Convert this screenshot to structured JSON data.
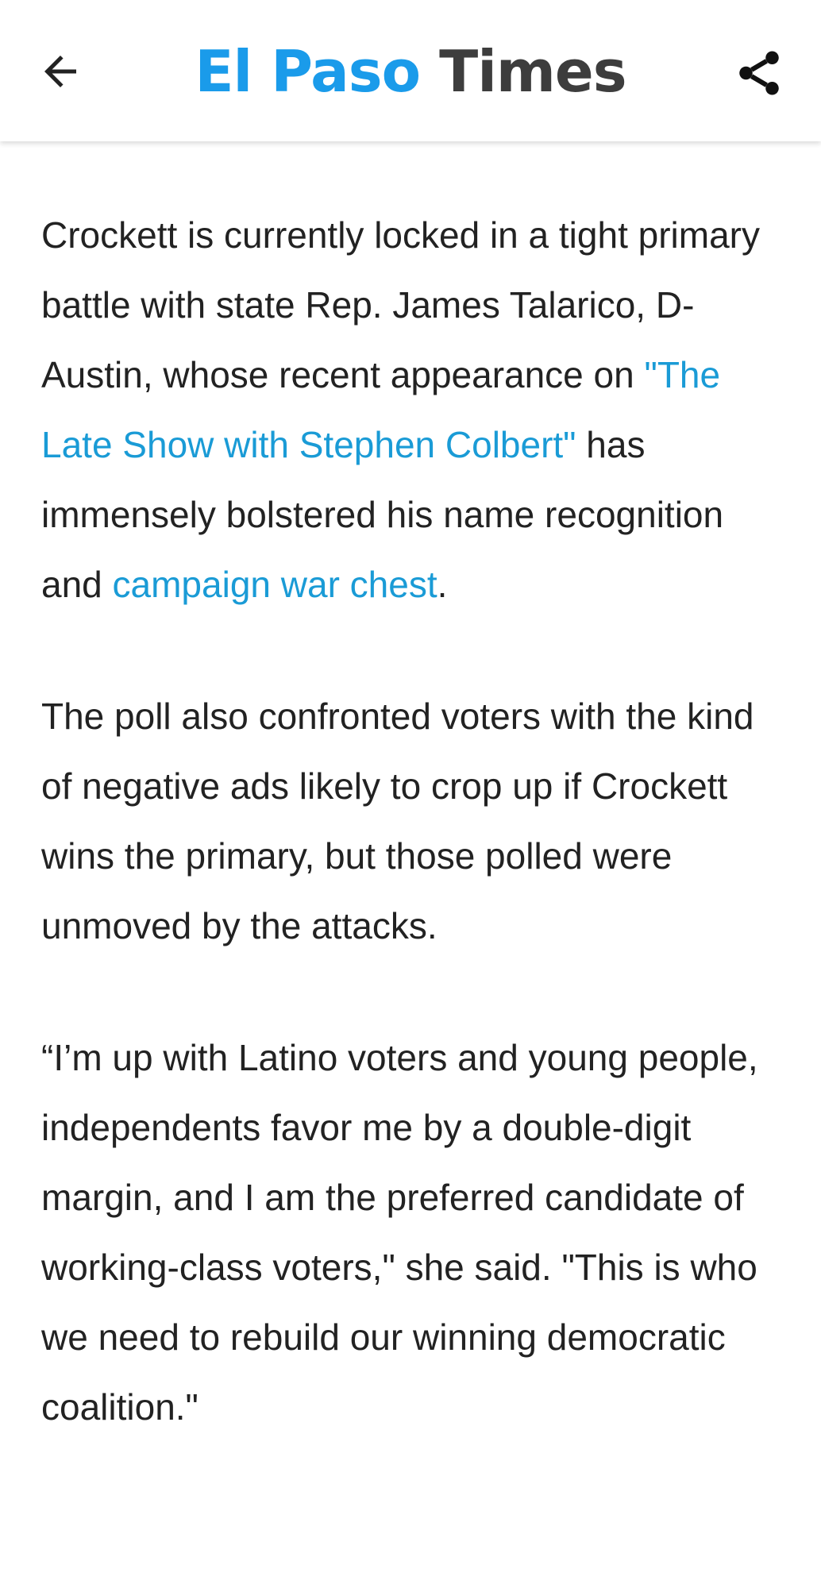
{
  "header": {
    "brand_part1": "El Paso",
    "brand_part2": "Times",
    "back_icon": "arrow-left-icon",
    "share_icon": "share-icon"
  },
  "article": {
    "p1": {
      "before_link1": "Crockett is currently locked in a tight pri­mary battle with state Rep. James Talarico, D-Austin, whose recent appear­ance on ",
      "link1": "\"The Late Show with Stephen Colbert\"",
      "between": " has immensely bolstered his name recognition and ",
      "link2": "campaign war chest",
      "after": "."
    },
    "p2": "The poll also confronted voters with the kind of negative ads likely to crop up if Crockett wins the primary, but those polled were unmoved by the attacks.",
    "p3": "“I’m up with Latino voters and young people, independents favor me by a dou­ble-digit margin, and I am the preferred candidate of working-class voters,\" she said. \"This is who we need to rebuild our winning democratic coalition.\""
  },
  "colors": {
    "brand_blue": "#1a9bea",
    "brand_dark": "#3d3d3d",
    "link": "#1a9bd6",
    "text": "#222222"
  }
}
